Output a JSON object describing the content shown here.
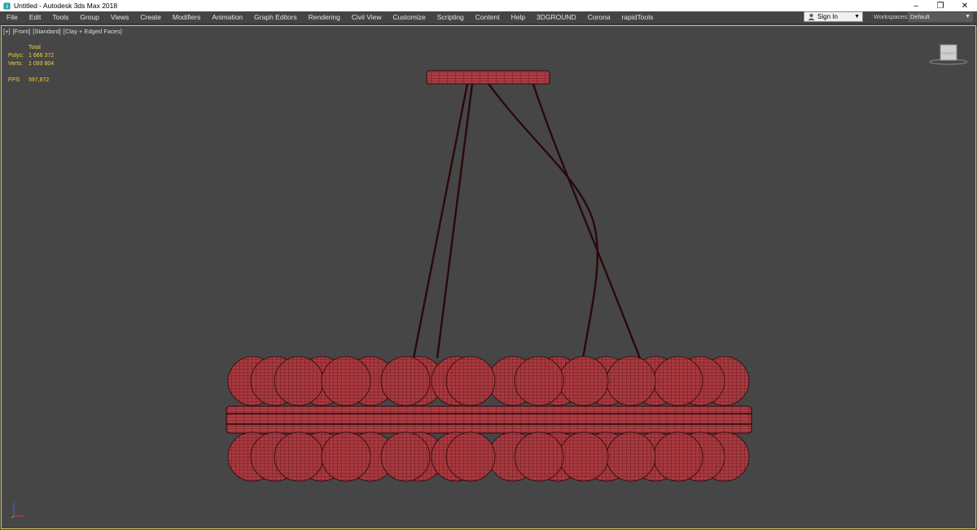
{
  "window": {
    "title": "Untitled - Autodesk 3ds Max 2018",
    "minimize": "–",
    "maximize": "❐",
    "close": "✕"
  },
  "menu": [
    "File",
    "Edit",
    "Tools",
    "Group",
    "Views",
    "Create",
    "Modifiers",
    "Animation",
    "Graph Editors",
    "Rendering",
    "Civil View",
    "Customize",
    "Scripting",
    "Content",
    "Help",
    "3DGROUND",
    "Corona",
    "rapidTools"
  ],
  "signin": {
    "label": "Sign In"
  },
  "workspaces": {
    "label": "Workspaces:",
    "value": "Default"
  },
  "viewport": {
    "labels": [
      "[+]",
      "[Front]",
      "[Standard]",
      "[Clay + Edged Faces]"
    ],
    "stats": {
      "header": "Total",
      "polys_label": "Polys:",
      "polys": "1 666 372",
      "verts_label": "Verts:",
      "verts": "1 093 804",
      "fps_label": "FPS:",
      "fps": "597,872"
    },
    "viewcube_label": "FRONT"
  },
  "colors": {
    "accent_yellow": "#f0d040",
    "model_fill": "#a8383d",
    "wire": "#3a0a0e",
    "viewport_bg": "#464646"
  }
}
